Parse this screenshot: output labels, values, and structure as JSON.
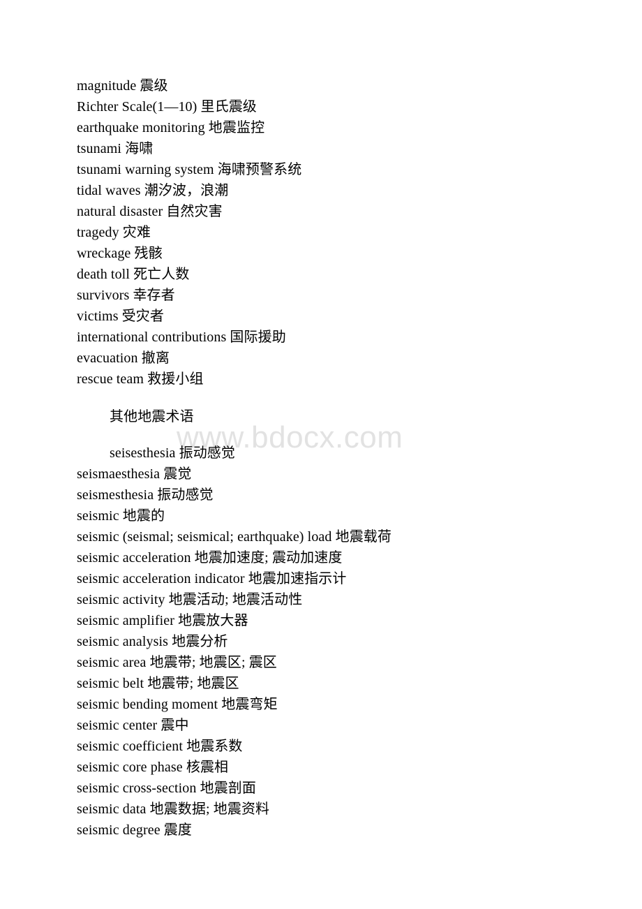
{
  "document": {
    "background_color": "#ffffff",
    "text_color": "#000000",
    "watermark": {
      "text": "www.bdocx.com",
      "color": "#e2e2e2"
    }
  },
  "glossary": {
    "section_one": {
      "entries": [
        {
          "term": "magnitude",
          "gloss": "震级",
          "line": "magnitude 震级"
        },
        {
          "term": "Richter Scale(1—10)",
          "gloss": "里氏震级",
          "line": "Richter Scale(1—10) 里氏震级"
        },
        {
          "term": "earthquake monitoring",
          "gloss": "地震监控",
          "line": "earthquake monitoring 地震监控"
        },
        {
          "term": "tsunami",
          "gloss": "海啸",
          "line": "tsunami 海啸"
        },
        {
          "term": "tsunami warning system",
          "gloss": "海啸预警系统",
          "line": "tsunami warning system 海啸预警系统"
        },
        {
          "term": "tidal waves",
          "gloss": "潮汐波，浪潮",
          "line": "tidal waves 潮汐波，浪潮"
        },
        {
          "term": "natural disaster",
          "gloss": "自然灾害",
          "line": "natural disaster 自然灾害"
        },
        {
          "term": "tragedy",
          "gloss": "灾难",
          "line": "tragedy 灾难"
        },
        {
          "term": "wreckage",
          "gloss": "残骸",
          "line": "wreckage 残骸"
        },
        {
          "term": "death toll",
          "gloss": "死亡人数",
          "line": "death toll 死亡人数"
        },
        {
          "term": "survivors",
          "gloss": "幸存者",
          "line": "survivors 幸存者"
        },
        {
          "term": "victims",
          "gloss": "受灾者",
          "line": "victims 受灾者"
        },
        {
          "term": "international contributions",
          "gloss": "国际援助",
          "line": "international contributions 国际援助"
        },
        {
          "term": "evacuation",
          "gloss": "撤离",
          "line": "evacuation 撤离"
        },
        {
          "term": "rescue team",
          "gloss": "救援小组",
          "line": "rescue team 救援小组"
        }
      ]
    },
    "section_two": {
      "heading": "其他地震术语",
      "first_entry": {
        "term": "seisesthesia",
        "gloss": "振动感觉",
        "line": "seisesthesia 振动感觉"
      },
      "entries": [
        {
          "term": "seismaesthesia",
          "gloss": "震觉",
          "line": "seismaesthesia 震觉"
        },
        {
          "term": "seismesthesia",
          "gloss": "振动感觉",
          "line": "seismesthesia 振动感觉"
        },
        {
          "term": "seismic",
          "gloss": "地震的",
          "line": "seismic 地震的"
        },
        {
          "term": "seismic (seismal; seismical; earthquake) load",
          "gloss": "地震载荷",
          "line": "seismic (seismal; seismical; earthquake) load 地震载荷"
        },
        {
          "term": "seismic acceleration",
          "gloss": "地震加速度; 震动加速度",
          "line": "seismic acceleration 地震加速度; 震动加速度"
        },
        {
          "term": "seismic acceleration indicator",
          "gloss": "地震加速指示计",
          "line": "seismic acceleration indicator 地震加速指示计"
        },
        {
          "term": "seismic activity",
          "gloss": "地震活动; 地震活动性",
          "line": "seismic activity 地震活动; 地震活动性"
        },
        {
          "term": "seismic amplifier",
          "gloss": "地震放大器",
          "line": "seismic amplifier 地震放大器"
        },
        {
          "term": "seismic analysis",
          "gloss": "地震分析",
          "line": "seismic analysis 地震分析"
        },
        {
          "term": "seismic area",
          "gloss": "地震带; 地震区; 震区",
          "line": "seismic area 地震带; 地震区; 震区"
        },
        {
          "term": "seismic belt",
          "gloss": "地震带; 地震区",
          "line": "seismic belt 地震带; 地震区"
        },
        {
          "term": "seismic bending moment",
          "gloss": "地震弯矩",
          "line": "seismic bending moment 地震弯矩"
        },
        {
          "term": "seismic center",
          "gloss": "震中",
          "line": "seismic center 震中"
        },
        {
          "term": "seismic coefficient",
          "gloss": "地震系数",
          "line": "seismic coefficient 地震系数"
        },
        {
          "term": "seismic core phase",
          "gloss": "核震相",
          "line": "seismic core phase 核震相"
        },
        {
          "term": "seismic cross-section",
          "gloss": "地震剖面",
          "line": "seismic cross-section 地震剖面"
        },
        {
          "term": "seismic data",
          "gloss": "地震数据; 地震资料",
          "line": "seismic data 地震数据; 地震资料"
        },
        {
          "term": "seismic degree",
          "gloss": "震度",
          "line": "seismic degree 震度"
        }
      ]
    }
  }
}
